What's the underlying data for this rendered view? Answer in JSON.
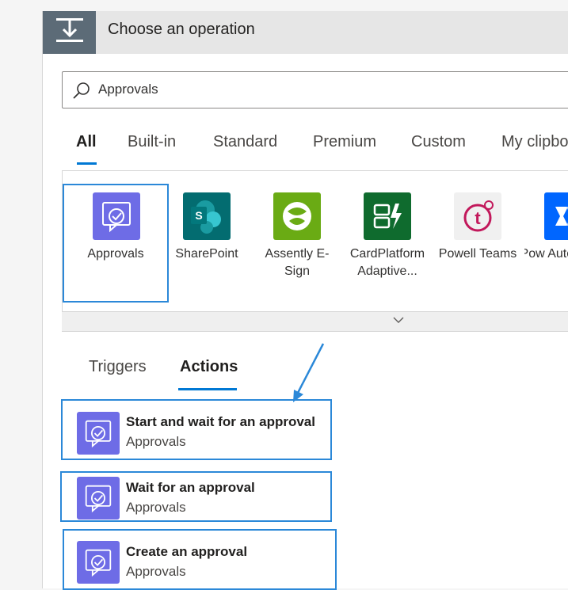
{
  "header": {
    "title": "Choose an operation",
    "icon": "trigger-operation-icon"
  },
  "search": {
    "value": "Approvals",
    "icon": "search-icon"
  },
  "category_tabs": [
    {
      "label": "All",
      "active": true
    },
    {
      "label": "Built-in"
    },
    {
      "label": "Standard"
    },
    {
      "label": "Premium"
    },
    {
      "label": "Custom"
    },
    {
      "label": "My clipbo"
    }
  ],
  "connectors": [
    {
      "label": "Approvals",
      "selected": true,
      "color": "#6e6ce6",
      "icon": "approvals-icon"
    },
    {
      "label": "SharePoint",
      "color": "#036c70",
      "icon": "sharepoint-icon"
    },
    {
      "label": "Assently E-Sign",
      "color": "#6aab14",
      "icon": "assently-icon"
    },
    {
      "label": "CardPlatform Adaptive...",
      "color": "#0f6b2e",
      "icon": "cardplatform-icon"
    },
    {
      "label": "Powell Teams",
      "color": "#f0f0f0",
      "icon": "powell-teams-icon"
    },
    {
      "label": "Pow Autom",
      "color": "#0066ff",
      "icon": "power-automate-icon"
    }
  ],
  "expander": {
    "icon": "chevron-down-icon"
  },
  "sub_tabs": [
    {
      "label": "Triggers"
    },
    {
      "label": "Actions",
      "active": true
    }
  ],
  "actions": [
    {
      "name": "Start and wait for an approval",
      "connector": "Approvals",
      "highlighted": true
    },
    {
      "name": "Wait for an approval",
      "connector": "Approvals",
      "highlighted": true
    },
    {
      "name": "Create an approval",
      "connector": "Approvals",
      "highlighted": true
    }
  ],
  "colors": {
    "accent": "#0078d4",
    "highlight": "#2b88d8",
    "approvals": "#6e6ce6"
  }
}
